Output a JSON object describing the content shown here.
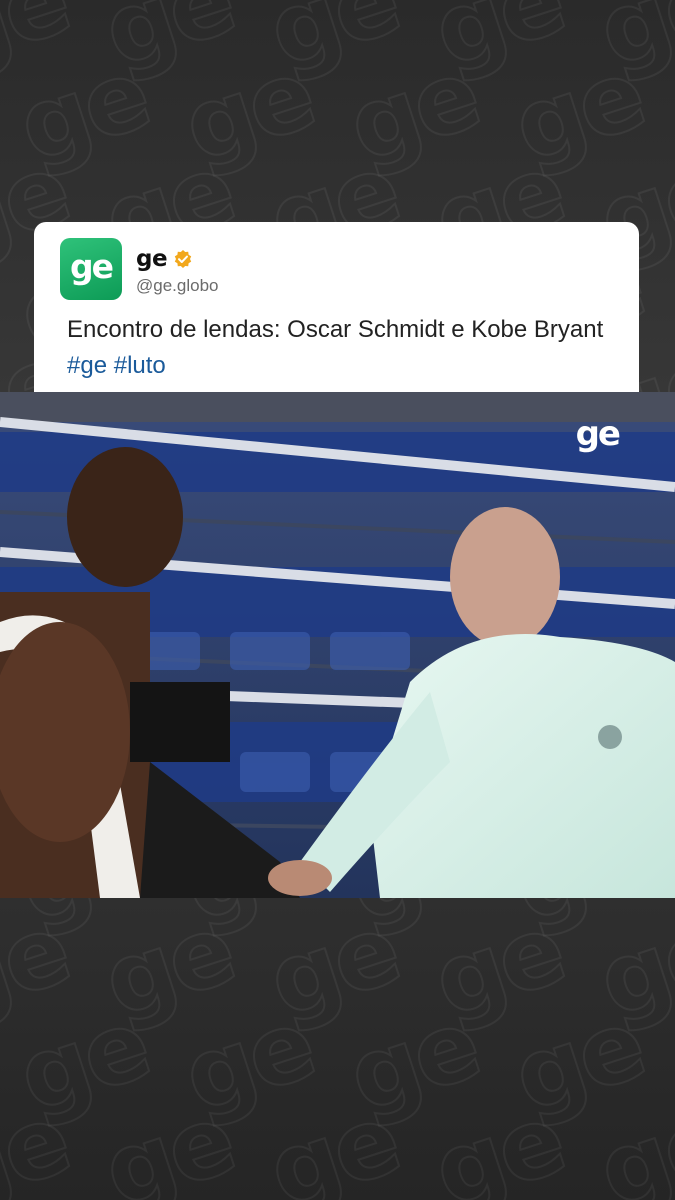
{
  "background": {
    "watermark_text": "ge",
    "color": "#333333"
  },
  "post": {
    "avatar_text": "ge",
    "account_name": "ge",
    "verified_icon": "verified-badge-icon",
    "handle": "@ge.globo",
    "text_main": "Encontro de lendas: Oscar Schmidt e Kobe Bryant ",
    "hashtags": [
      "#ge",
      "#luto"
    ]
  },
  "video": {
    "watermark_logo": "ge"
  },
  "colors": {
    "brand_green": "#11a35c",
    "hashtag_blue": "#1a5a9a",
    "verified_gold": "#f2a81d"
  }
}
